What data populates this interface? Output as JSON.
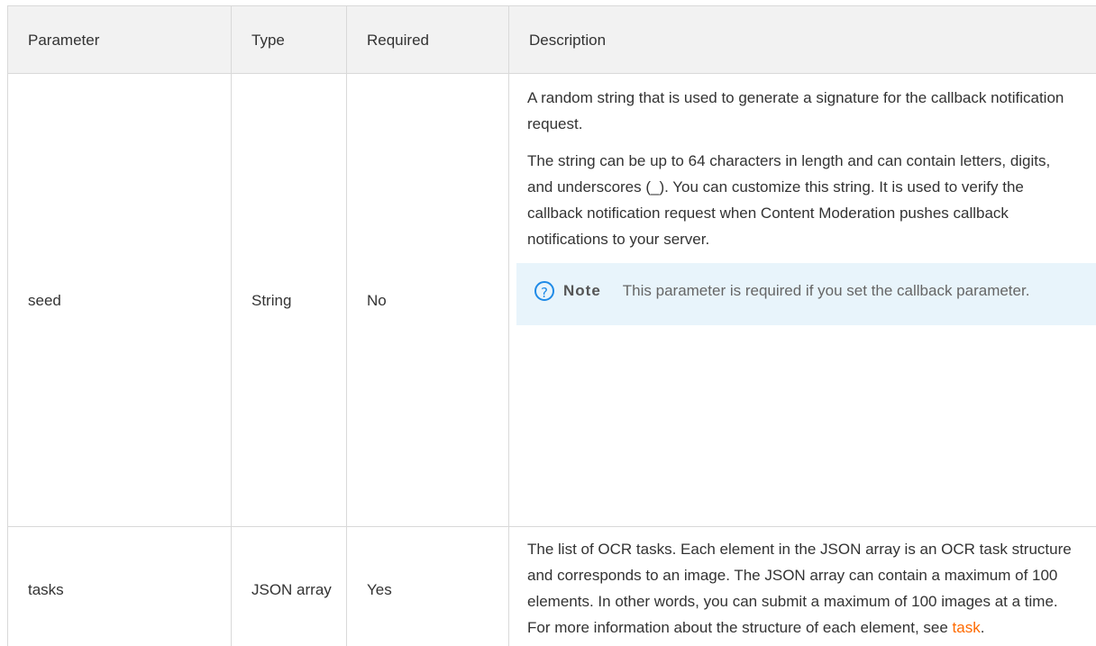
{
  "table": {
    "headers": [
      "Parameter",
      "Type",
      "Required",
      "Description"
    ],
    "rows": [
      {
        "parameter": "seed",
        "type": "String",
        "required": "No",
        "description": {
          "paragraphs": [
            "A random string that is used to generate a signature for the callback notification request.",
            "The string can be up to 64 characters in length and can contain letters, digits, and underscores (_). You can customize this string. It is used to verify the callback notification request when Content Moderation pushes callback notifications to your server."
          ],
          "note": {
            "icon": "question-circle-icon",
            "label": "Note",
            "text": "This parameter is required if you set the callback parameter."
          }
        }
      },
      {
        "parameter": "tasks",
        "type": "JSON array",
        "required": "Yes",
        "description": {
          "text_before_link": "The list of OCR tasks. Each element in the JSON array is an OCR task structure and corresponds to an image. The JSON array can contain a maximum of 100 elements. In other words, you can submit a maximum of 100 images at a time. For more information about the structure of each element, see ",
          "link_text": "task",
          "text_after_link": "."
        }
      }
    ]
  },
  "colors": {
    "header_bg": "#f2f2f2",
    "border": "#d9d9d9",
    "note_bg": "#e8f4fb",
    "note_icon": "#1e8ae7",
    "link": "#ff6a00",
    "text": "#333333"
  }
}
